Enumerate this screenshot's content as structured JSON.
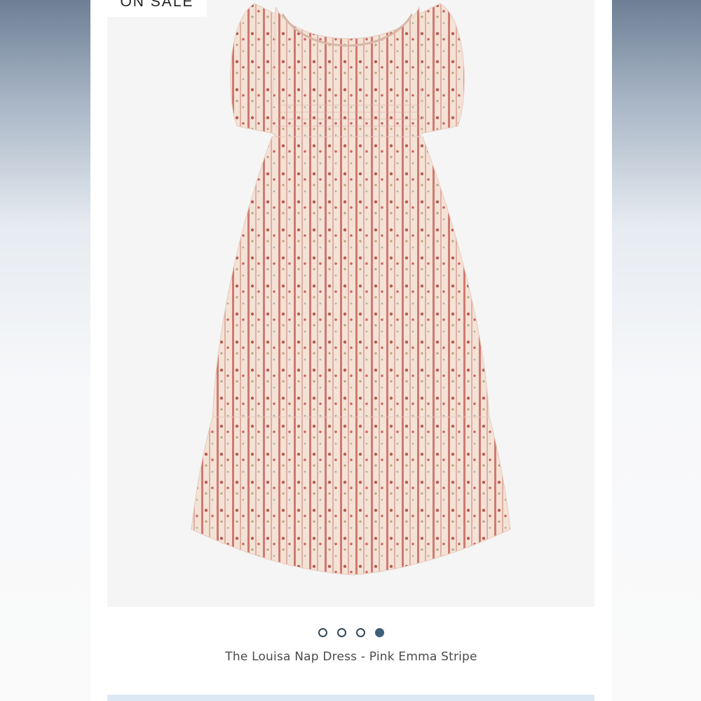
{
  "badge": {
    "label": "ON SALE"
  },
  "carousel": {
    "total": 4,
    "active_index": 4,
    "dots": [
      {
        "label": "slide-1"
      },
      {
        "label": "slide-2"
      },
      {
        "label": "slide-3"
      },
      {
        "label": "slide-4"
      }
    ]
  },
  "product": {
    "title": "The Louisa Nap Dress - Pink Emma Stripe"
  },
  "colors": {
    "dress_base": "#f4e2d6",
    "stripe": "#c9665f",
    "dot_active": "#3f5f78",
    "dot_border": "#334a5c"
  }
}
